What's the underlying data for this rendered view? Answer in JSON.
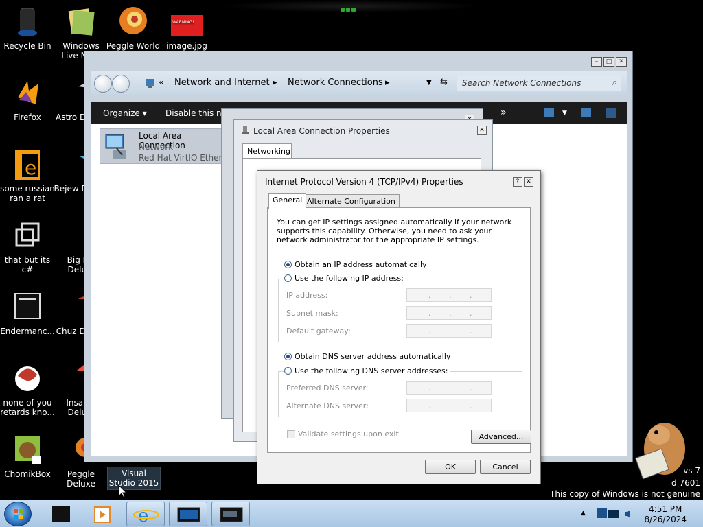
{
  "desktop": {
    "icons": [
      {
        "label": "Recycle Bin"
      },
      {
        "label": "Windows Live Ma..."
      },
      {
        "label": "Peggle World"
      },
      {
        "label": "image.jpg"
      },
      {
        "label": "Firefox"
      },
      {
        "label": "Astro Delu..."
      },
      {
        "label": "some russian ran a rat"
      },
      {
        "label": "Bejew Delu..."
      },
      {
        "label": "that but its c#"
      },
      {
        "label": "Big Mo Delu..."
      },
      {
        "label": "Endermanc..."
      },
      {
        "label": "Chuz Delu..."
      },
      {
        "label": "none of you retards kno..."
      },
      {
        "label": "Insaniq Delu..."
      },
      {
        "label": "ChomikBox"
      },
      {
        "label": "Peggle Deluxe"
      }
    ],
    "image_thumb_text": "WARNING!",
    "tooltip": "Visual Studio 2015",
    "watermark": {
      "line1": "vs 7",
      "line2": "d 7601",
      "line3": "This copy of Windows is not genuine"
    }
  },
  "explorer": {
    "breadcrumb": {
      "sep": "«",
      "part1": "Network and Internet",
      "part2": "Network Connections"
    },
    "search_placeholder": "Search Network Connections",
    "toolbar": {
      "organize": "Organize ▾",
      "disable": "Disable this net",
      "more": "»"
    },
    "item": {
      "name": "Local Area Connection",
      "status": "Network",
      "device": "Red Hat VirtIO Etherne"
    }
  },
  "lan_props": {
    "title": "Local Area Connection Properties",
    "tab": "Networking"
  },
  "ipv4": {
    "title": "Internet Protocol Version 4 (TCP/IPv4) Properties",
    "help": "?",
    "close": "✕",
    "tabs": {
      "general": "General",
      "alternate": "Alternate Configuration"
    },
    "intro": "You can get IP settings assigned automatically if your network supports this capability. Otherwise, you need to ask your network administrator for the appropriate IP settings.",
    "ip_auto": "Obtain an IP address automatically",
    "ip_manual": "Use the following IP address:",
    "ip_address": "IP address:",
    "subnet_mask": "Subnet mask:",
    "default_gateway": "Default gateway:",
    "dns_auto": "Obtain DNS server address automatically",
    "dns_manual": "Use the following DNS server addresses:",
    "preferred_dns": "Preferred DNS server:",
    "alternate_dns": "Alternate DNS server:",
    "validate": "Validate settings upon exit",
    "advanced": "Advanced...",
    "ok": "OK",
    "cancel": "Cancel",
    "dot": "."
  },
  "taskbar": {
    "time": "4:51 PM",
    "date": "8/26/2024"
  }
}
